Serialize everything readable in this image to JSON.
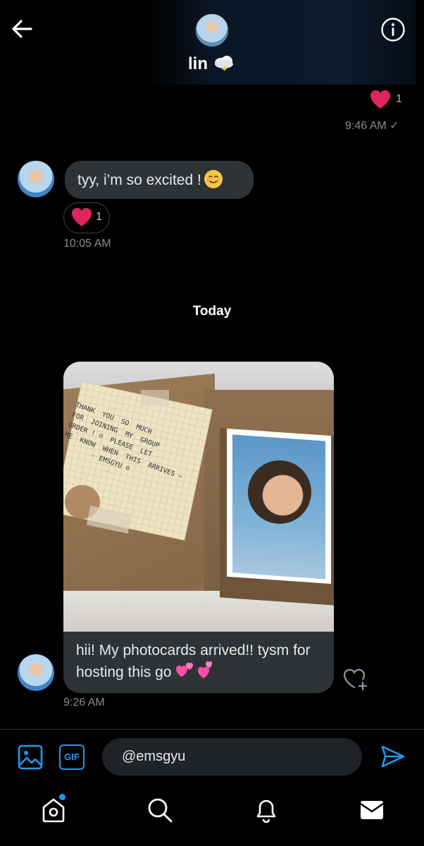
{
  "header": {
    "contact_name": "lin",
    "name_emoji_icon": "cloud-lightning-icon",
    "back_icon": "back-arrow-icon",
    "info_icon": "info-icon"
  },
  "thread": {
    "sent_reaction": {
      "icon": "heart-icon",
      "count": "1",
      "time": "9:46 AM ✓"
    },
    "received_1": {
      "text": "tyy, i’m so excited !",
      "emoji_icon": "smiling-face-icon",
      "reaction_count": "1",
      "time": "10:05 AM"
    },
    "day_separator": "Today",
    "received_2": {
      "note_text": "THANK  YOU  SO  MUCH\nFOR  JOINING  MY  GROUP\nORDER ! ☺  PLEASE  LET\nME  KNOW  WHEN  THIS  ARRIVES ~\n        - EMSGYU ☺",
      "caption": "hii! My photocards arrived!! tysm for hosting this go",
      "caption_emoji_icon": "two-hearts-icon",
      "time": "9:26 AM"
    }
  },
  "composer": {
    "input_value": "@emsgyu",
    "gif_label": "GIF"
  },
  "colors": {
    "accent": "#1d9bf0",
    "bubble": "#2f3336",
    "heart": "#e0245e"
  }
}
